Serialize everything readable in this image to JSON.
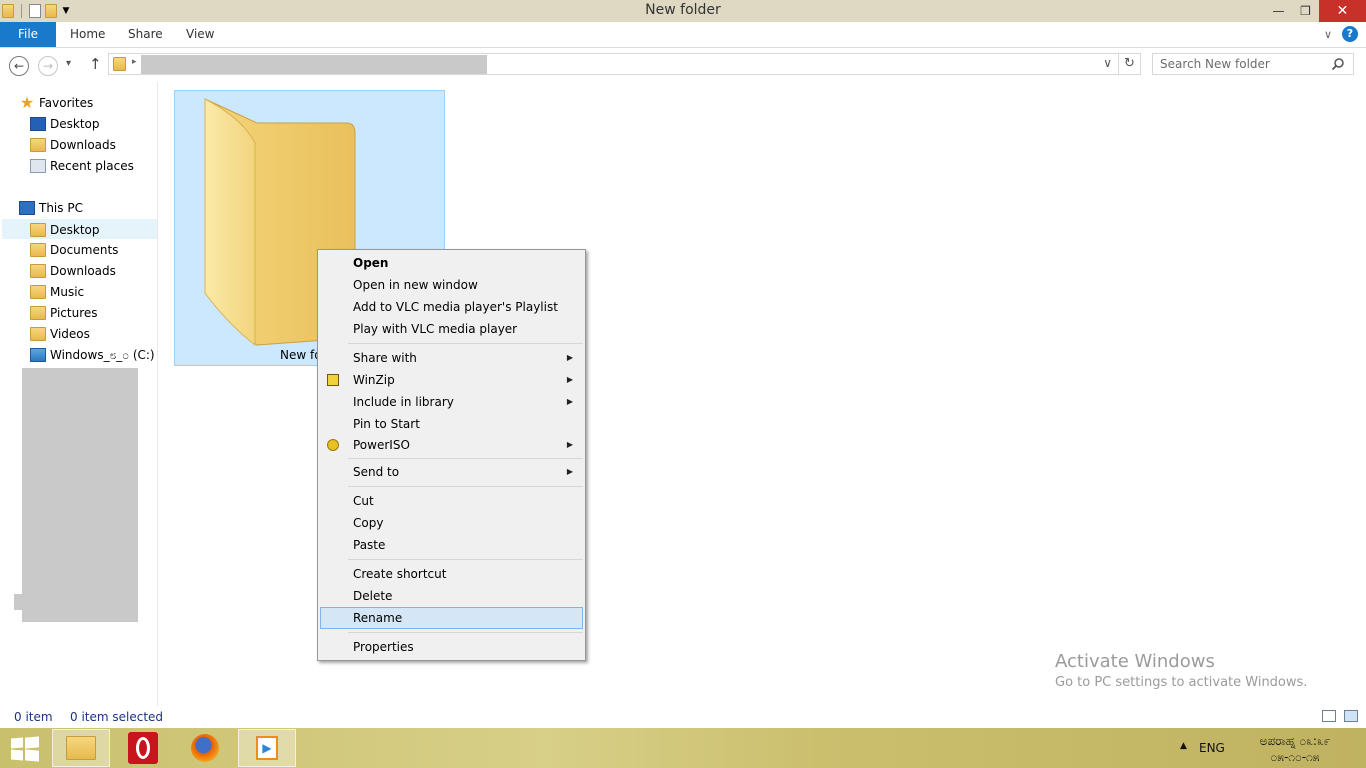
{
  "window": {
    "title": "New folder",
    "controls": {
      "minimize": "—",
      "maximize": "❒",
      "close": "✕"
    }
  },
  "ribbon": {
    "tabs": [
      "File",
      "Home",
      "Share",
      "View"
    ],
    "help": "?"
  },
  "navigation": {
    "back": "←",
    "forward": "→",
    "recent": "▾",
    "up": "↑",
    "address_dropdown": "∨",
    "refresh": "↻",
    "search_placeholder": "Search New folder"
  },
  "sidebar": {
    "favorites": {
      "label": "Favorites",
      "items": [
        "Desktop",
        "Downloads",
        "Recent places"
      ]
    },
    "this_pc": {
      "label": "This PC",
      "items": [
        "Desktop",
        "Documents",
        "Downloads",
        "Music",
        "Pictures",
        "Videos",
        "Windows_೮_೦ (C:)"
      ]
    }
  },
  "content": {
    "item_label": "New fo"
  },
  "context_menu": {
    "items": [
      {
        "label": "Open",
        "bold": true
      },
      {
        "label": "Open in new window"
      },
      {
        "label": "Add to VLC media player's Playlist"
      },
      {
        "label": "Play with VLC media player"
      },
      {
        "label": "Share with",
        "submenu": true
      },
      {
        "label": "WinZip",
        "submenu": true,
        "icon": "winzip-icon"
      },
      {
        "label": "Include in library",
        "submenu": true
      },
      {
        "label": "Pin to Start"
      },
      {
        "label": "PowerISO",
        "submenu": true,
        "icon": "poweriso-icon"
      },
      {
        "label": "Send to",
        "submenu": true
      },
      {
        "label": "Cut"
      },
      {
        "label": "Copy"
      },
      {
        "label": "Paste"
      },
      {
        "label": "Create shortcut"
      },
      {
        "label": "Delete"
      },
      {
        "label": "Rename",
        "highlighted": true
      },
      {
        "label": "Properties"
      }
    ]
  },
  "statusbar": {
    "item_count": "0 item",
    "selected_count": "0 item selected"
  },
  "watermark": {
    "line1": "Activate Windows",
    "line2": "Go to PC settings to activate Windows."
  },
  "taskbar": {
    "language": "ENG",
    "time": "ಅಪರಾಹ್ನ ೦೩:೩೯",
    "date": "೦೫-೧೦-೧೫",
    "apps": [
      "file-explorer",
      "opera",
      "firefox",
      "media-player"
    ]
  },
  "colors": {
    "accent": "#1979ca",
    "selection": "#cce8ff",
    "menu_highlight": "#d5e7f7",
    "close_button": "#c7312a",
    "titlebar": "#dfd9c4"
  }
}
